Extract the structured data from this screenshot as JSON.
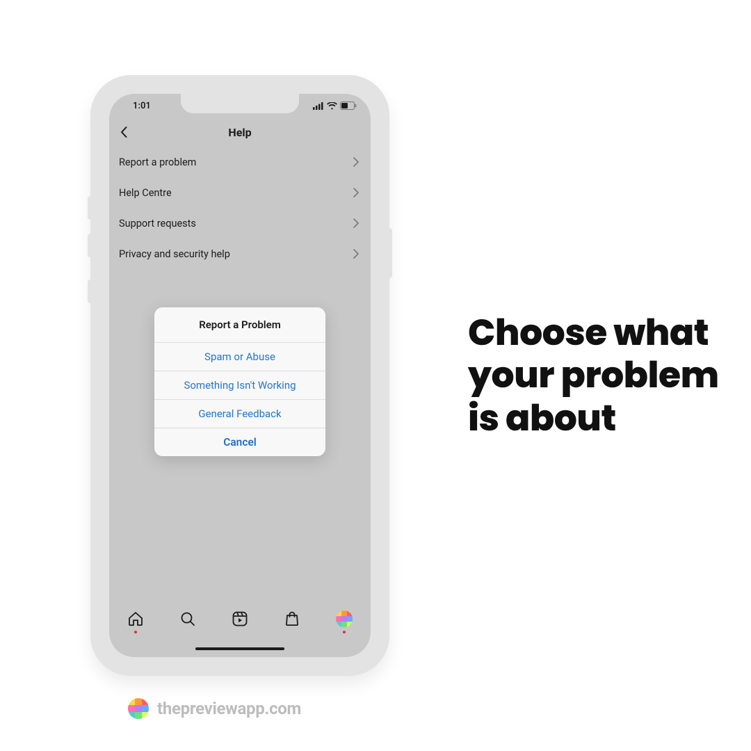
{
  "status": {
    "time": "1:01"
  },
  "header": {
    "title": "Help"
  },
  "menu": {
    "items": [
      {
        "label": "Report a problem"
      },
      {
        "label": "Help Centre"
      },
      {
        "label": "Support requests"
      },
      {
        "label": "Privacy and security help"
      }
    ]
  },
  "dialog": {
    "title": "Report a Problem",
    "options": [
      "Spam or Abuse",
      "Something Isn't Working",
      "General Feedback"
    ],
    "cancel": "Cancel"
  },
  "heading": "Choose what your problem is about",
  "brand": {
    "url": "thepreviewapp.com"
  }
}
